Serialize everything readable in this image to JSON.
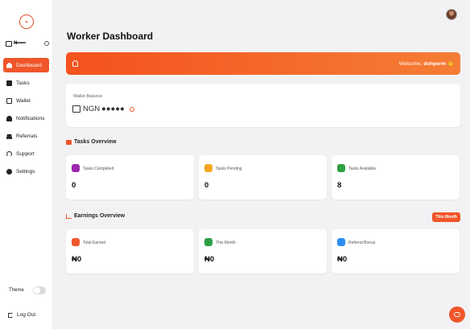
{
  "sidebar": {
    "balance_masked": "₦••••••",
    "items": [
      {
        "label": "Dashboard",
        "icon": "home-icon",
        "active": true
      },
      {
        "label": "Tasks",
        "icon": "tasks-icon"
      },
      {
        "label": "Wallet",
        "icon": "wallet-icon"
      },
      {
        "label": "Notifications",
        "icon": "bell-icon"
      },
      {
        "label": "Referrals",
        "icon": "users-icon"
      },
      {
        "label": "Support",
        "icon": "support-icon"
      },
      {
        "label": "Settings",
        "icon": "gear-icon"
      }
    ],
    "theme_label": "Theme",
    "logout_label": "Log Out"
  },
  "header": {
    "title": "Worker Dashboard"
  },
  "banner": {
    "welcome_prefix": "Welcome, ",
    "username": "dohperm",
    "emoji": "👋"
  },
  "wallet": {
    "label": "Wallet Balance",
    "value": "NGN ●●●●●"
  },
  "tasks_overview": {
    "title": "Tasks Overview",
    "stats": [
      {
        "label": "Tasks Completed",
        "value": "0",
        "color": "#9c27b0"
      },
      {
        "label": "Tasks Pending",
        "value": "0",
        "color": "#f5a623"
      },
      {
        "label": "Tasks Available",
        "value": "8",
        "color": "#2ea043"
      }
    ]
  },
  "earnings_overview": {
    "title": "Earnings Overview",
    "badge": "This Month",
    "stats": [
      {
        "label": "Total Earned",
        "value": "₦0",
        "color": "#f0562a"
      },
      {
        "label": "This Month",
        "value": "₦0",
        "color": "#2ea043"
      },
      {
        "label": "Referral Bonus",
        "value": "₦0",
        "color": "#2d8ef0"
      }
    ]
  },
  "colors": {
    "accent": "#f0562a",
    "background": "#f2f2f4"
  }
}
